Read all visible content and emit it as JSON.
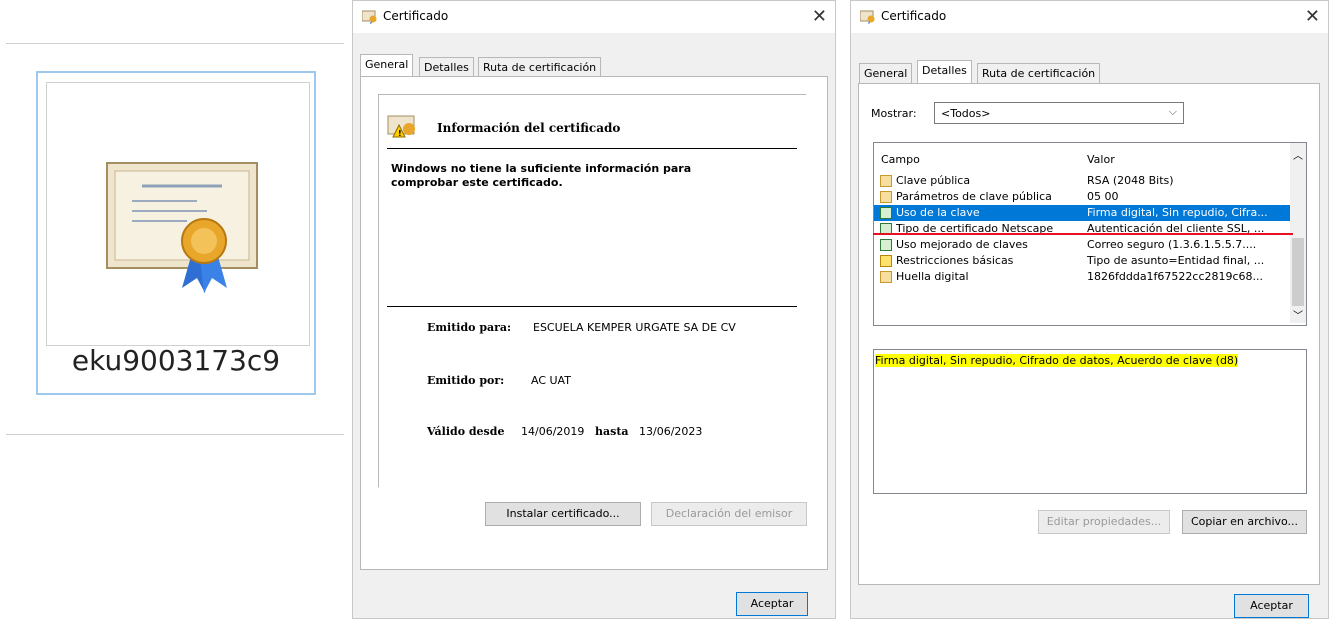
{
  "file_tile": {
    "name": "eku9003173c9"
  },
  "dialog1": {
    "title": "Certificado",
    "tabs": [
      "General",
      "Detalles",
      "Ruta de certificación"
    ],
    "info_title": "Información del certificado",
    "message": "Windows no tiene la suficiente información para comprobar este certificado.",
    "issued_to_label": "Emitido para:",
    "issued_to_value": "ESCUELA KEMPER URGATE SA DE CV",
    "issued_by_label": "Emitido por:",
    "issued_by_value": "AC UAT",
    "valid_from_label": "Válido desde",
    "valid_from_value": "14/06/2019",
    "valid_to_label": "hasta",
    "valid_to_value": "13/06/2023",
    "install_button": "Instalar certificado...",
    "issuer_statement_button": "Declaración del emisor",
    "ok_button": "Aceptar"
  },
  "dialog2": {
    "title": "Certificado",
    "tabs": [
      "General",
      "Detalles",
      "Ruta de certificación"
    ],
    "show_label": "Mostrar:",
    "show_value": "<Todos>",
    "col_field": "Campo",
    "col_value": "Valor",
    "rows": [
      {
        "field": "Clave pública",
        "value": "RSA (2048 Bits)",
        "icon": "doc"
      },
      {
        "field": "Parámetros de clave pública",
        "value": "05 00",
        "icon": "doc"
      },
      {
        "field": "Uso de la clave",
        "value": "Firma digital, Sin repudio, Cifra...",
        "icon": "ext"
      },
      {
        "field": "Tipo de certificado Netscape",
        "value": "Autenticación del cliente SSL, ...",
        "icon": "ext"
      },
      {
        "field": "Uso mejorado de claves",
        "value": "Correo seguro (1.3.6.1.5.5.7....",
        "icon": "ext"
      },
      {
        "field": "Restricciones básicas",
        "value": "Tipo de asunto=Entidad final, ...",
        "icon": "warn"
      },
      {
        "field": "Huella digital",
        "value": "1826fddda1f67522cc2819c68...",
        "icon": "doc"
      }
    ],
    "detail_text": "Firma digital, Sin repudio, Cifrado de datos, Acuerdo de clave (d8)",
    "edit_button": "Editar propiedades...",
    "copy_button": "Copiar en archivo...",
    "ok_button": "Aceptar"
  },
  "colors": {
    "selection": "#0078d7",
    "highlight": "#ffff00",
    "annotation": "#e81123"
  }
}
